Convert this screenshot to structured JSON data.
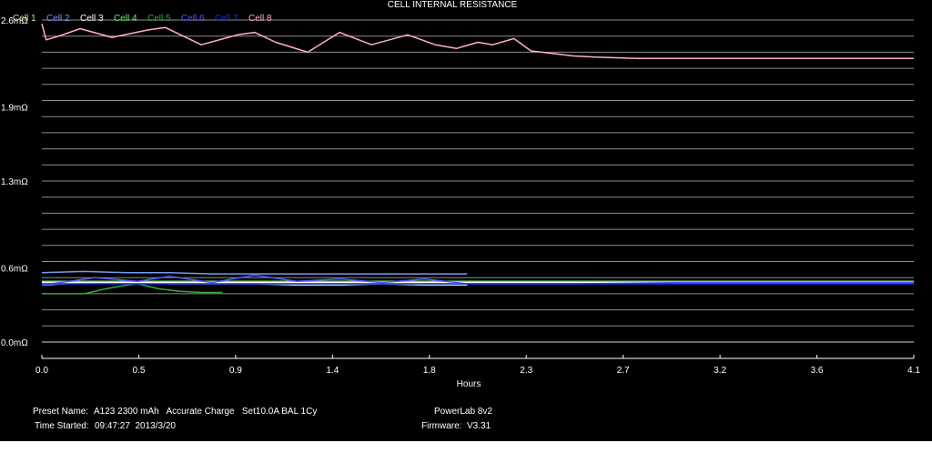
{
  "chart_data": {
    "type": "line",
    "title": "CELL INTERNAL RESISTANCE",
    "xlabel": "Hours",
    "ylabel": "",
    "x_ticks": [
      "0.0",
      "0.5",
      "0.9",
      "1.4",
      "1.8",
      "2.3",
      "2.7",
      "3.2",
      "3.6",
      "4.1"
    ],
    "y_ticks": [
      {
        "value": 0.0,
        "label": "0.0mΩ"
      },
      {
        "value": 0.6,
        "label": "0.6mΩ"
      },
      {
        "value": 1.3,
        "label": "1.3mΩ"
      },
      {
        "value": 1.9,
        "label": "1.9mΩ"
      },
      {
        "value": 2.6,
        "label": "2.6mΩ"
      }
    ],
    "xlim": [
      0.0,
      4.1
    ],
    "ylim": [
      0.0,
      2.6
    ],
    "grid": "horizontal",
    "legend_placement": "top-left",
    "series": [
      {
        "name": "Cell 1",
        "color": "#c8e89a",
        "x": [
          0.0,
          0.2,
          0.4,
          0.6,
          0.8,
          1.0,
          1.2,
          1.4,
          1.6,
          1.8,
          2.0
        ],
        "y": [
          0.46,
          0.48,
          0.49,
          0.47,
          0.47,
          0.47,
          0.46,
          0.46,
          0.47,
          0.46,
          0.46
        ]
      },
      {
        "name": "Cell 2",
        "color": "#7799ee",
        "x": [
          0.0,
          0.2,
          0.4,
          0.6,
          0.8,
          1.0,
          1.2,
          1.4,
          1.6,
          1.8,
          2.0
        ],
        "y": [
          0.56,
          0.57,
          0.56,
          0.56,
          0.55,
          0.55,
          0.55,
          0.55,
          0.55,
          0.55,
          0.55
        ]
      },
      {
        "name": "Cell 3",
        "color": "#ffffff",
        "x": [
          0.0,
          0.5,
          1.0,
          1.5,
          2.0,
          2.5,
          3.0,
          3.5,
          4.1
        ],
        "y": [
          0.48,
          0.48,
          0.48,
          0.48,
          0.48,
          0.48,
          0.48,
          0.48,
          0.48
        ]
      },
      {
        "name": "Cell 4",
        "color": "#66ee66",
        "x": [
          0.0,
          0.5,
          1.0,
          1.5,
          2.0,
          2.5,
          3.0,
          3.5,
          4.1
        ],
        "y": [
          0.49,
          0.49,
          0.49,
          0.49,
          0.49,
          0.49,
          0.49,
          0.49,
          0.49
        ]
      },
      {
        "name": "Cell 5",
        "color": "#33aa33",
        "x": [
          0.0,
          0.2,
          0.3,
          0.4,
          0.45,
          0.55,
          0.65,
          0.75,
          0.85
        ],
        "y": [
          0.39,
          0.39,
          0.43,
          0.46,
          0.47,
          0.43,
          0.41,
          0.4,
          0.4
        ]
      },
      {
        "name": "Cell 6",
        "color": "#5555ff",
        "x": [
          0.0,
          0.25,
          0.45,
          0.6,
          0.8,
          1.0,
          1.2,
          1.4,
          1.6,
          1.8,
          2.0,
          2.5,
          3.0,
          3.5,
          4.1
        ],
        "y": [
          0.46,
          0.52,
          0.49,
          0.53,
          0.48,
          0.54,
          0.49,
          0.51,
          0.48,
          0.51,
          0.47,
          0.47,
          0.48,
          0.48,
          0.48
        ]
      },
      {
        "name": "Cell 7",
        "color": "#1133ee",
        "x": [
          0.0,
          0.5,
          1.0,
          1.5,
          2.0,
          2.5,
          3.0,
          3.5,
          4.1
        ],
        "y": [
          0.47,
          0.47,
          0.47,
          0.47,
          0.47,
          0.47,
          0.47,
          0.47,
          0.47
        ]
      },
      {
        "name": "Cell 8",
        "color": "#ffb0c8",
        "x": [
          0.0,
          0.02,
          0.08,
          0.18,
          0.33,
          0.5,
          0.58,
          0.75,
          0.92,
          1.0,
          1.1,
          1.25,
          1.4,
          1.55,
          1.72,
          1.85,
          1.95,
          2.05,
          2.12,
          2.22,
          2.3,
          2.4,
          2.5,
          2.6,
          2.8,
          3.2,
          3.6,
          4.1
        ],
        "y": [
          2.57,
          2.44,
          2.47,
          2.53,
          2.46,
          2.52,
          2.54,
          2.4,
          2.48,
          2.5,
          2.42,
          2.34,
          2.5,
          2.4,
          2.48,
          2.4,
          2.37,
          2.42,
          2.4,
          2.45,
          2.35,
          2.33,
          2.31,
          2.3,
          2.29,
          2.29,
          2.29,
          2.29
        ]
      }
    ]
  },
  "info": {
    "preset_label": "Preset Name:",
    "preset_value": "A123 2300 mAh   Accurate Charge   Set10.0A BAL 1Cy",
    "time_label": "Time Started:",
    "time_value": "09:47:27  2013/3/20",
    "device_name": "PowerLab 8v2",
    "firmware_label": "Firmware:",
    "firmware_value": "V3.31"
  }
}
